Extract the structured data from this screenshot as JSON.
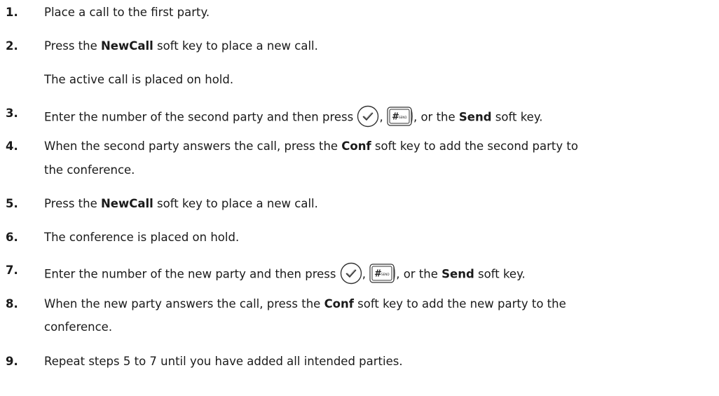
{
  "steps": [
    {
      "number": "1.",
      "text": "Place a call to the first party."
    },
    {
      "number": "2.",
      "pre": "Press the ",
      "bold": "NewCall",
      "post": " soft key to place a new call.",
      "note": "The active call is placed on hold."
    },
    {
      "number": "3.",
      "pre": "Enter the number of the second party and then press ",
      "sep": ", ",
      "mid": ", or the ",
      "bold": "Send",
      "post": " soft key."
    },
    {
      "number": "4.",
      "pre": "When the second party answers the call, press the ",
      "bold": "Conf",
      "post": " soft key to add the second party to",
      "cont": "the conference."
    },
    {
      "number": "5.",
      "pre": "Press the ",
      "bold": "NewCall",
      "post": " soft key to place a new call."
    },
    {
      "number": "6.",
      "text": "The conference is placed on hold."
    },
    {
      "number": "7.",
      "pre": "Enter the number of the new party and then press ",
      "sep": ", ",
      "mid": ", or the ",
      "bold": "Send",
      "post": " soft key."
    },
    {
      "number": "8.",
      "pre": "When the new party answers the call, press the ",
      "bold": "Conf",
      "post": " soft key to add the new party to the",
      "cont": "conference."
    },
    {
      "number": "9.",
      "text": "Repeat steps 5 to 7 until you have added all intended parties."
    }
  ],
  "send_key_label": "SEND"
}
